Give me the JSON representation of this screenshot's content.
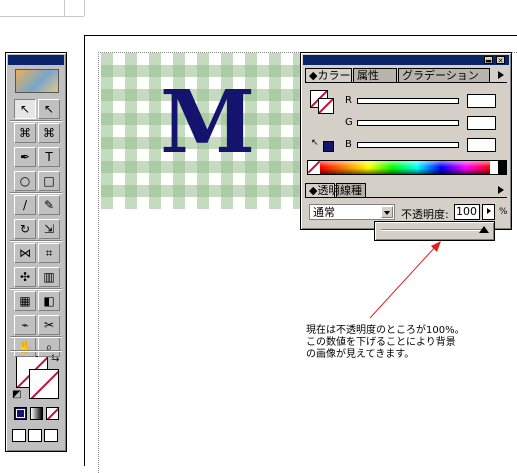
{
  "colors": {
    "titlebar": "#0a246a",
    "panel_bg": "#d4d0c8",
    "pattern_green": "#96be8c",
    "letter_color": "#14146e",
    "none_slash": "#c0103a",
    "annotation_arrow": "#e02020"
  },
  "artwork": {
    "letter": "M"
  },
  "toolbox": {
    "tools": [
      {
        "name": "selection-tool",
        "glyph": "↖"
      },
      {
        "name": "direct-selection-tool",
        "glyph": "↖"
      },
      {
        "name": "lasso-tool",
        "glyph": "⌘"
      },
      {
        "name": "direct-lasso-tool",
        "glyph": "⌘"
      },
      {
        "name": "pen-tool",
        "glyph": "✒"
      },
      {
        "name": "type-tool",
        "glyph": "T"
      },
      {
        "name": "ellipse-tool",
        "glyph": "○"
      },
      {
        "name": "rectangle-tool",
        "glyph": "□"
      },
      {
        "name": "paintbrush-tool",
        "glyph": "/"
      },
      {
        "name": "pencil-tool",
        "glyph": "✎"
      },
      {
        "name": "rotate-tool",
        "glyph": "↻"
      },
      {
        "name": "scale-tool",
        "glyph": "⇲"
      },
      {
        "name": "reflect-tool",
        "glyph": "⋈"
      },
      {
        "name": "free-transform-tool",
        "glyph": "⌗"
      },
      {
        "name": "symbol-sprayer-tool",
        "glyph": "✣"
      },
      {
        "name": "graph-tool",
        "glyph": "▥"
      },
      {
        "name": "mesh-tool",
        "glyph": "▦"
      },
      {
        "name": "gradient-tool",
        "glyph": "◧"
      },
      {
        "name": "eyedropper-tool",
        "glyph": "⌁"
      },
      {
        "name": "scissors-tool",
        "glyph": "✂"
      },
      {
        "name": "hand-tool",
        "glyph": "✋"
      },
      {
        "name": "zoom-tool",
        "glyph": "⌕"
      }
    ],
    "swap_glyph": "⇆",
    "default_glyph": "◩"
  },
  "color_panel": {
    "tabs": [
      "◆カラー",
      "属性",
      "グラデーション"
    ],
    "sliders": [
      {
        "label": "R",
        "value": ""
      },
      {
        "label": "G",
        "value": ""
      },
      {
        "label": "B",
        "value": ""
      }
    ],
    "menu_glyph": "▶"
  },
  "transparency_panel": {
    "tabs": [
      "◆透明",
      "線種"
    ],
    "blend_mode": "通常",
    "opacity_label": "不透明度:",
    "opacity_value": "100",
    "percent": "%"
  },
  "annotation": {
    "lines": [
      "現在は不透明度のところが100%。",
      "この数値を下げることにより背景",
      "の画像が見えてきます。"
    ]
  }
}
